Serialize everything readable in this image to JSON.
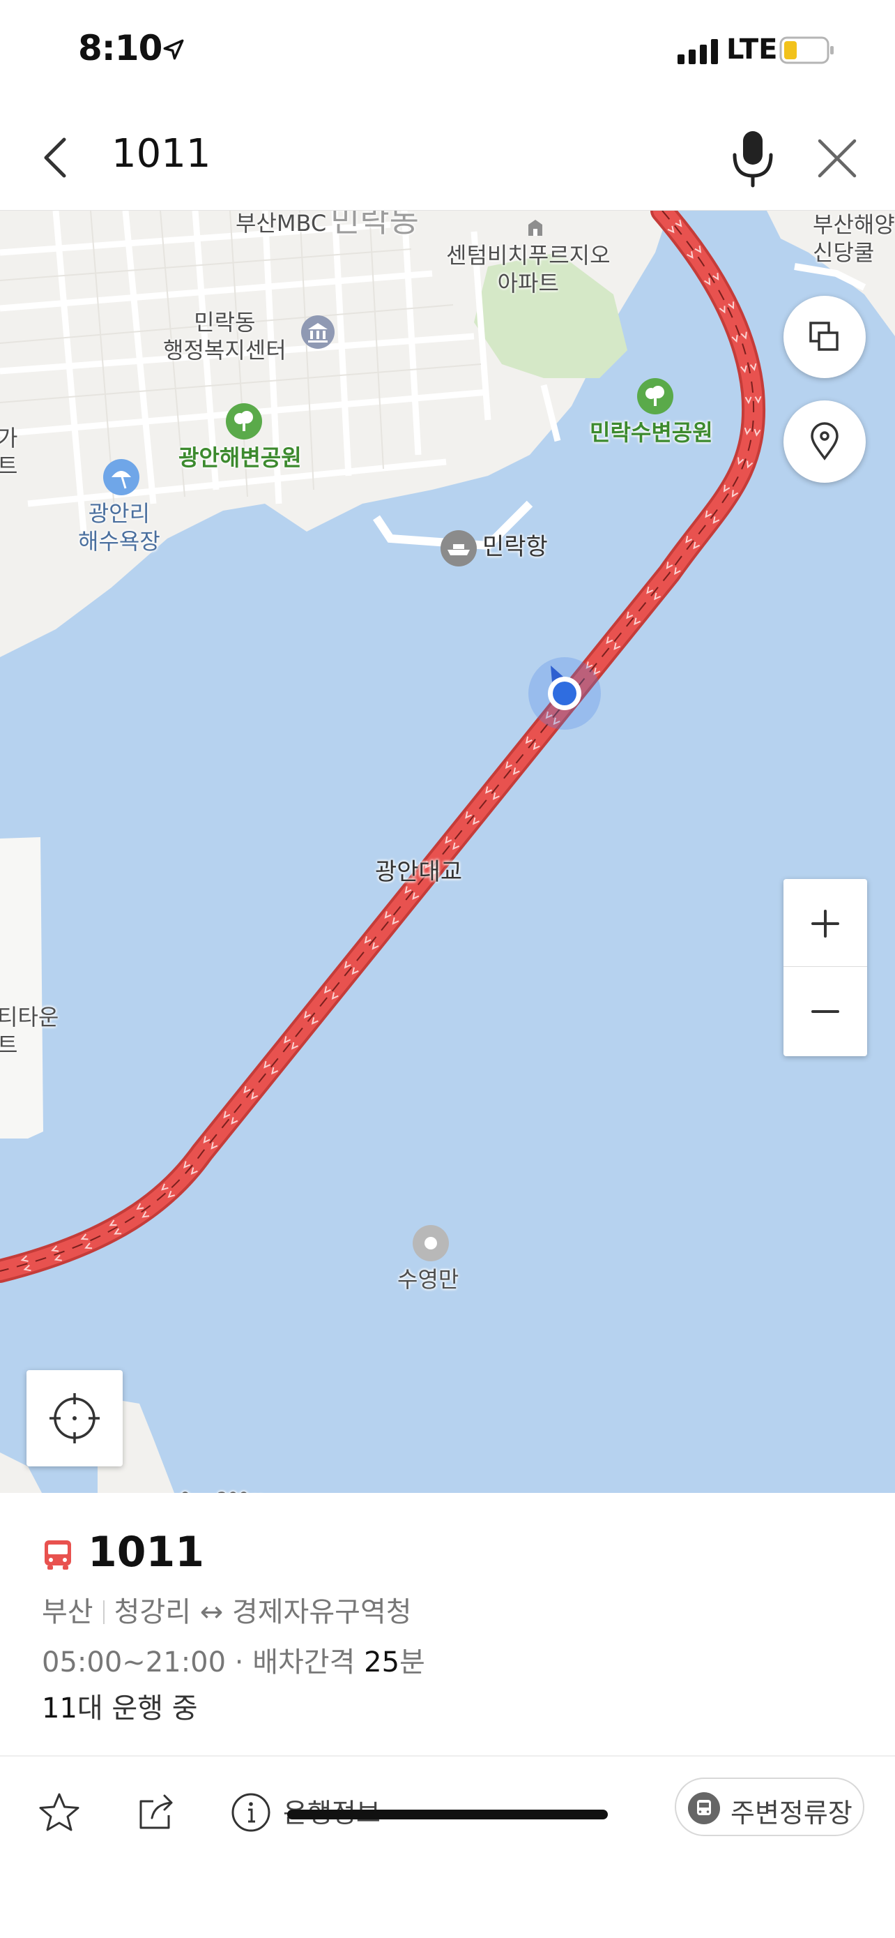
{
  "status_bar": {
    "time": "8:10",
    "network": "LTE"
  },
  "search": {
    "query": "1011"
  },
  "map": {
    "labels": {
      "busan_mbc": "부산MBC",
      "dong": "민락동",
      "centum_beach": "센텀비치푸르지오\n아파트",
      "busan_haeyang": "부산해양\n신당쿨",
      "admin_center": "민락동\n행정복지센터",
      "gwangan_park": "광안해변공원",
      "minrak_park": "민락수변공원",
      "gwangalli_beach": "광안리\n해수욕장",
      "minrak_port": "민락항",
      "left_edge_top": "가\n트",
      "gwangan_bridge": "광안대교",
      "left_edge_mid": "티타운\n트",
      "suyeong_bay": "수영만",
      "scale": "0     200m"
    },
    "route_color": "#e8524f",
    "water_color": "#b6d2ef",
    "land_color": "#f2f1ee"
  },
  "route": {
    "number": "1011",
    "region": "부산",
    "path": "청강리 ↔ 경제자유구역청",
    "hours": "05:00~21:00",
    "interval_prefix": " · 배차간격 ",
    "interval_value": "25",
    "interval_unit": "분",
    "running_count": "11",
    "running_suffix": "대 운행 중"
  },
  "actions": {
    "info_label": "운행정보",
    "nearby_label": "주변정류장"
  }
}
